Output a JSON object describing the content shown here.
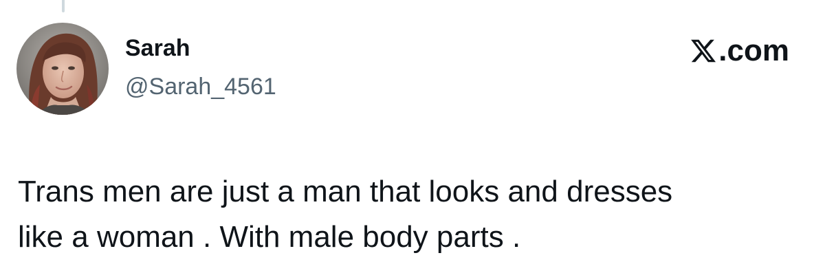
{
  "tweet": {
    "author": {
      "display_name": "Sarah",
      "handle": "@Sarah_4561",
      "avatar": "profile-photo"
    },
    "brand": {
      "logo_icon": "x-logo-icon",
      "domain_suffix": ".com"
    },
    "text": "Trans men are just a man that looks and dresses\nlike a woman . With male body parts ."
  },
  "colors": {
    "text_primary": "#0f1419",
    "text_secondary": "#536471",
    "thread_line": "#cfd9de",
    "background": "#ffffff"
  }
}
